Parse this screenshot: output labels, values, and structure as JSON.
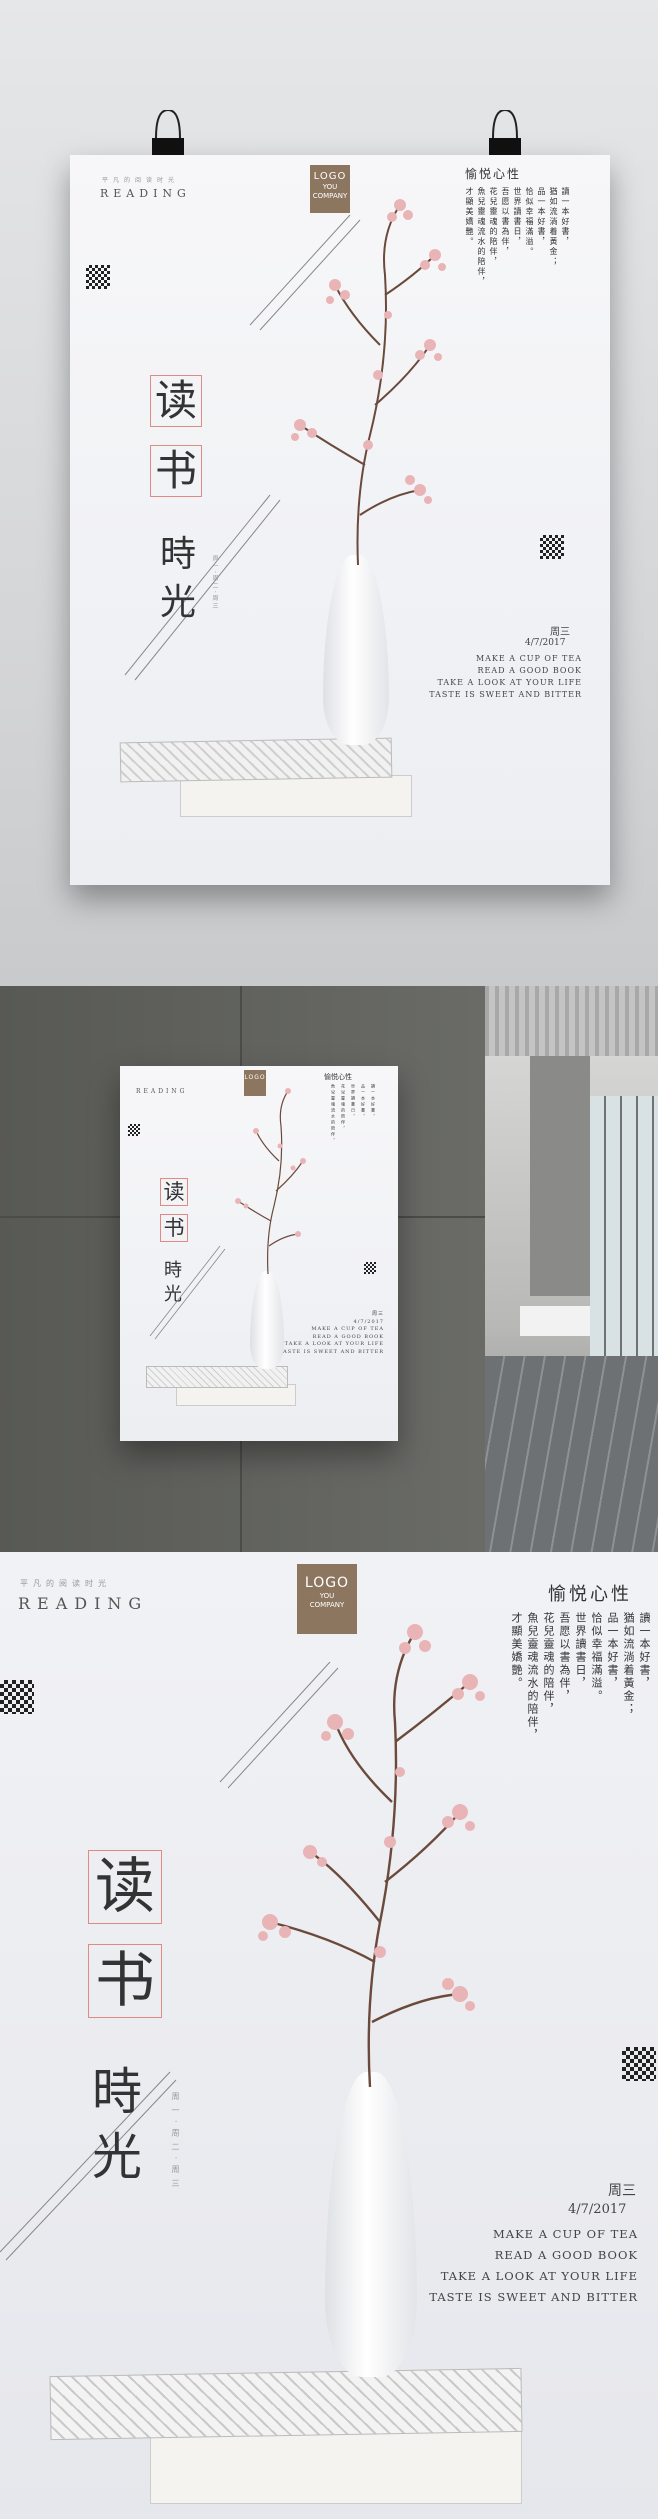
{
  "poster": {
    "reading": "READING",
    "tiny_chars": "平凡的阅读时光",
    "logo": {
      "main": "LOGO",
      "line2": "YOU",
      "line3": "COMPANY"
    },
    "title_char_1": "读",
    "title_char_2": "书",
    "subtitle_char_1": "時",
    "subtitle_char_2": "光",
    "right_heading": "愉悦心性",
    "poem_col_1": "讀一本好書，",
    "poem_col_2": "品一本好書，",
    "poem_col_3": "世界讀書日，",
    "poem_col_4": "花兒靈魂的陪伴，",
    "poem_col_5": "魚兒靈魂流水的陪伴，",
    "poem_col_6": "猶如流淌着黃金；",
    "poem_col_7": "恰似幸福滿溢。",
    "poem_col_8": "吾愿以書為伴，",
    "poem_col_9": "才顯美嬌艷。",
    "weekday": "周三",
    "date": "4/7/2017",
    "eng_1": "MAKE A CUP OF TEA",
    "eng_2": "READ A GOOD BOOK",
    "eng_3": "TAKE A LOOK AT YOUR LIFE",
    "eng_4": "TASTE IS SWEET AND BITTER",
    "side_text": "周一·周二·周三"
  },
  "colors": {
    "logo_bg": "#8c7660",
    "accent_pink": "#e08a86",
    "blossom": "#e9b4b6",
    "branch": "#6b4a3c"
  }
}
